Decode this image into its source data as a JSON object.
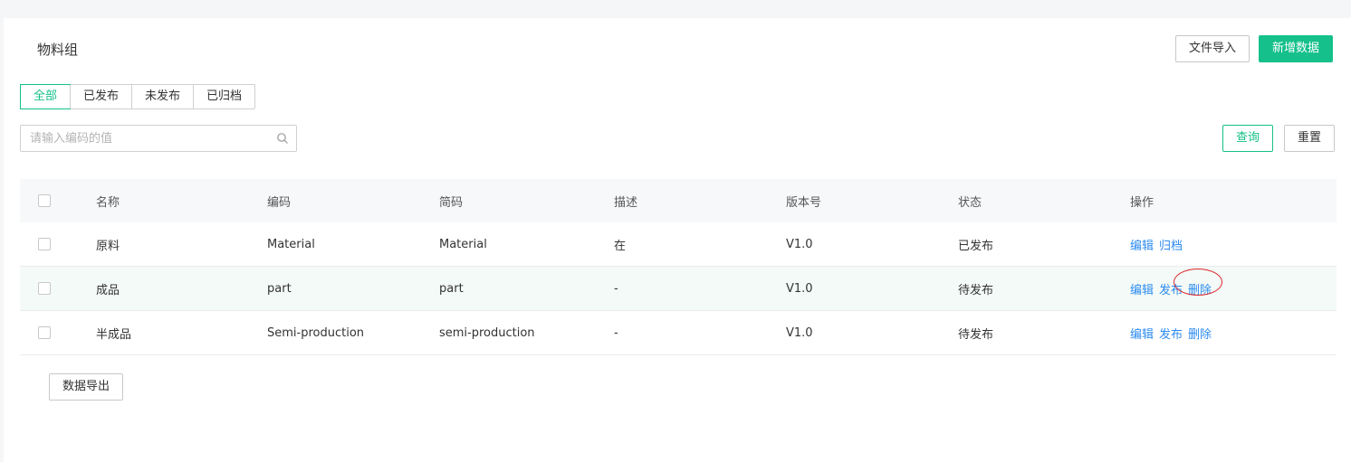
{
  "page": {
    "title": "物料组"
  },
  "toolbar": {
    "import_label": "文件导入",
    "add_label": "新增数据"
  },
  "tabs": [
    {
      "label": "全部",
      "active": true
    },
    {
      "label": "已发布",
      "active": false
    },
    {
      "label": "未发布",
      "active": false
    },
    {
      "label": "已归档",
      "active": false
    }
  ],
  "search": {
    "placeholder": "请输入编码的值",
    "value": "",
    "icon": "search-icon"
  },
  "filter": {
    "query_label": "查询",
    "reset_label": "重置"
  },
  "table": {
    "headers": [
      "名称",
      "编码",
      "简码",
      "描述",
      "版本号",
      "状态",
      "操作"
    ],
    "rows": [
      {
        "name": "原料",
        "code": "Material",
        "abbr": "Material",
        "desc": "在",
        "version": "V1.0",
        "status": "已发布",
        "ops": [
          "编辑",
          "归档"
        ]
      },
      {
        "name": "成品",
        "code": "part",
        "abbr": "part",
        "desc": "-",
        "version": "V1.0",
        "status": "待发布",
        "ops": [
          "编辑",
          "发布",
          "删除"
        ]
      },
      {
        "name": "半成品",
        "code": "Semi-production",
        "abbr": "semi-production",
        "desc": "-",
        "version": "V1.0",
        "status": "待发布",
        "ops": [
          "编辑",
          "发布",
          "删除"
        ]
      }
    ]
  },
  "footer": {
    "export_label": "数据导出"
  },
  "colors": {
    "primary": "#15c08a",
    "link": "#2d8cf0",
    "annotation": "#e0282e"
  }
}
